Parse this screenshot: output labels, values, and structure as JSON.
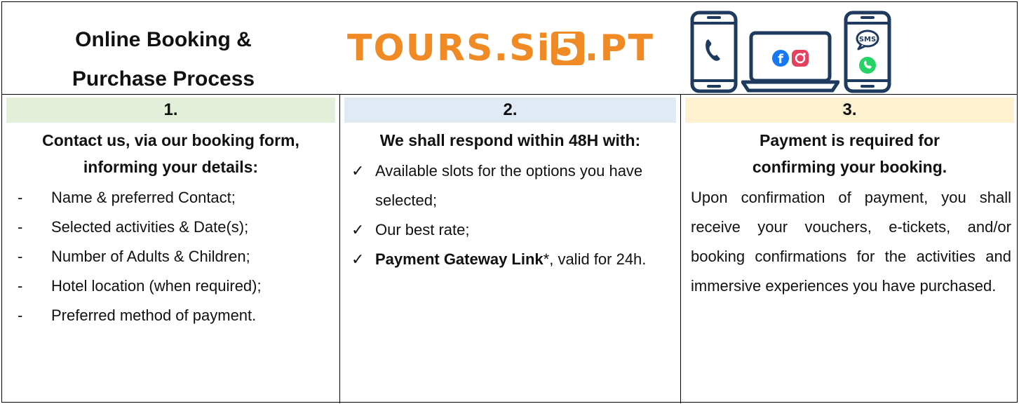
{
  "header": {
    "title_line1": "Online Booking &",
    "title_line2": "Purchase Process",
    "logo": {
      "part1": "TOURS.",
      "part2": "Si",
      "mark": "5",
      "part3": ".PT"
    },
    "icons": [
      "phone-device-icon",
      "laptop-social-icon",
      "phone-messaging-icon"
    ],
    "sms_label": "SMS"
  },
  "steps": [
    {
      "number": "1.",
      "heading_line1": "Contact us, via our booking form,",
      "heading_line2": "informing your details:",
      "items": [
        "Name & preferred Contact;",
        "Selected activities & Date(s);",
        "Number of Adults & Children;",
        "Hotel location (when required);",
        "Preferred method of payment."
      ],
      "marker": "-"
    },
    {
      "number": "2.",
      "heading_line1": "We shall respond within 48H with:",
      "items": [
        "Available slots for the options you have selected;",
        "Our best rate;"
      ],
      "item3_bold": "Payment Gateway Link",
      "item3_rest": "*, valid for 24h.",
      "marker": "✓"
    },
    {
      "number": "3.",
      "heading_line1": "Payment is required for",
      "heading_line2": "confirming your booking.",
      "paragraph": "Upon confirmation of payment, you shall receive your vouchers, e-tickets, and/or booking confirmations for the activities and immersive experiences you have purchased."
    }
  ],
  "colors": {
    "logo": "#f08a24",
    "step1_bg": "#e3efd9",
    "step2_bg": "#dfeaf5",
    "step3_bg": "#fdf1cf",
    "device_stroke": "#1f3a5f",
    "facebook": "#1877f2",
    "instagram": "#e4405f",
    "whatsapp": "#25d366"
  }
}
